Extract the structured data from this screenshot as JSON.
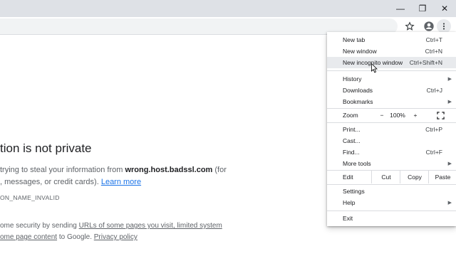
{
  "window": {
    "minimize_glyph": "—",
    "maximize_glyph": "❐",
    "close_glyph": "✕"
  },
  "toolbar": {
    "icons": [
      "star-icon",
      "profile-icon",
      "kebab-menu-icon"
    ]
  },
  "page": {
    "heading": "tion is not private",
    "para1_line1_prefix": "trying to steal your information from ",
    "para1_host": "wrong.host.badssl.com",
    "para1_line1_suffix": " (for",
    "para1_line2_prefix": ", messages, or credit cards). ",
    "para1_link": "Learn more",
    "error_code": "ON_NAME_INVALID",
    "para2_line1_prefix": "ome security by sending ",
    "para2_line1_link": "URLs of some pages you visit, limited system",
    "para2_line2_link": "ome page content",
    "para2_line2_mid": " to Google. ",
    "para2_line2_link2": "Privacy policy"
  },
  "menu": {
    "new_tab": "New tab",
    "new_tab_sc": "Ctrl+T",
    "new_window": "New window",
    "new_window_sc": "Ctrl+N",
    "new_incognito": "New incognito window",
    "new_incognito_sc": "Ctrl+Shift+N",
    "history": "History",
    "downloads": "Downloads",
    "downloads_sc": "Ctrl+J",
    "bookmarks": "Bookmarks",
    "zoom": "Zoom",
    "zoom_minus": "−",
    "zoom_value": "100%",
    "zoom_plus": "+",
    "print": "Print...",
    "print_sc": "Ctrl+P",
    "cast": "Cast...",
    "find": "Find...",
    "find_sc": "Ctrl+F",
    "more_tools": "More tools",
    "edit": "Edit",
    "cut": "Cut",
    "copy": "Copy",
    "paste": "Paste",
    "settings": "Settings",
    "help": "Help",
    "exit": "Exit"
  },
  "colors": {
    "titlebar": "#dee1e6",
    "highlight": "#e8eaed",
    "link": "#1a73e8"
  }
}
